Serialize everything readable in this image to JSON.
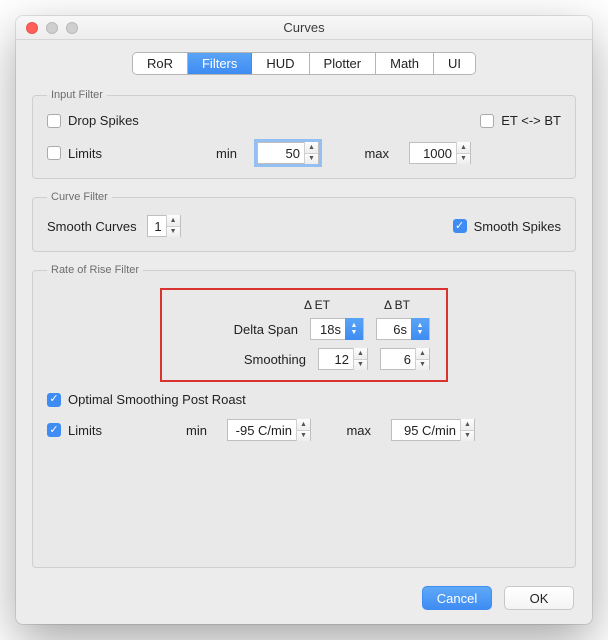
{
  "window": {
    "title": "Curves"
  },
  "tabs": [
    "RoR",
    "Filters",
    "HUD",
    "Plotter",
    "Math",
    "UI"
  ],
  "tabs_active_index": 1,
  "input_filter": {
    "legend": "Input Filter",
    "drop_spikes": {
      "label": "Drop Spikes",
      "checked": false
    },
    "et_bt": {
      "label": "ET <-> BT",
      "checked": false
    },
    "limits": {
      "label": "Limits",
      "checked": false
    },
    "min_label": "min",
    "min_value": "50",
    "max_label": "max",
    "max_value": "1000"
  },
  "curve_filter": {
    "legend": "Curve Filter",
    "smooth_label": "Smooth Curves",
    "smooth_value": "1",
    "smooth_spikes": {
      "label": "Smooth Spikes",
      "checked": true
    }
  },
  "ror_filter": {
    "legend": "Rate of Rise Filter",
    "col_et": "Δ ET",
    "col_bt": "Δ BT",
    "delta_span_label": "Delta Span",
    "delta_span_et": "18s",
    "delta_span_bt": "6s",
    "smoothing_label": "Smoothing",
    "smoothing_et": "12",
    "smoothing_bt": "6",
    "optimal": {
      "label": "Optimal Smoothing Post Roast",
      "checked": true
    },
    "limits": {
      "label": "Limits",
      "checked": true
    },
    "min_label": "min",
    "min_value": "-95 C/min",
    "max_label": "max",
    "max_value": "95 C/min"
  },
  "buttons": {
    "cancel": "Cancel",
    "ok": "OK"
  }
}
